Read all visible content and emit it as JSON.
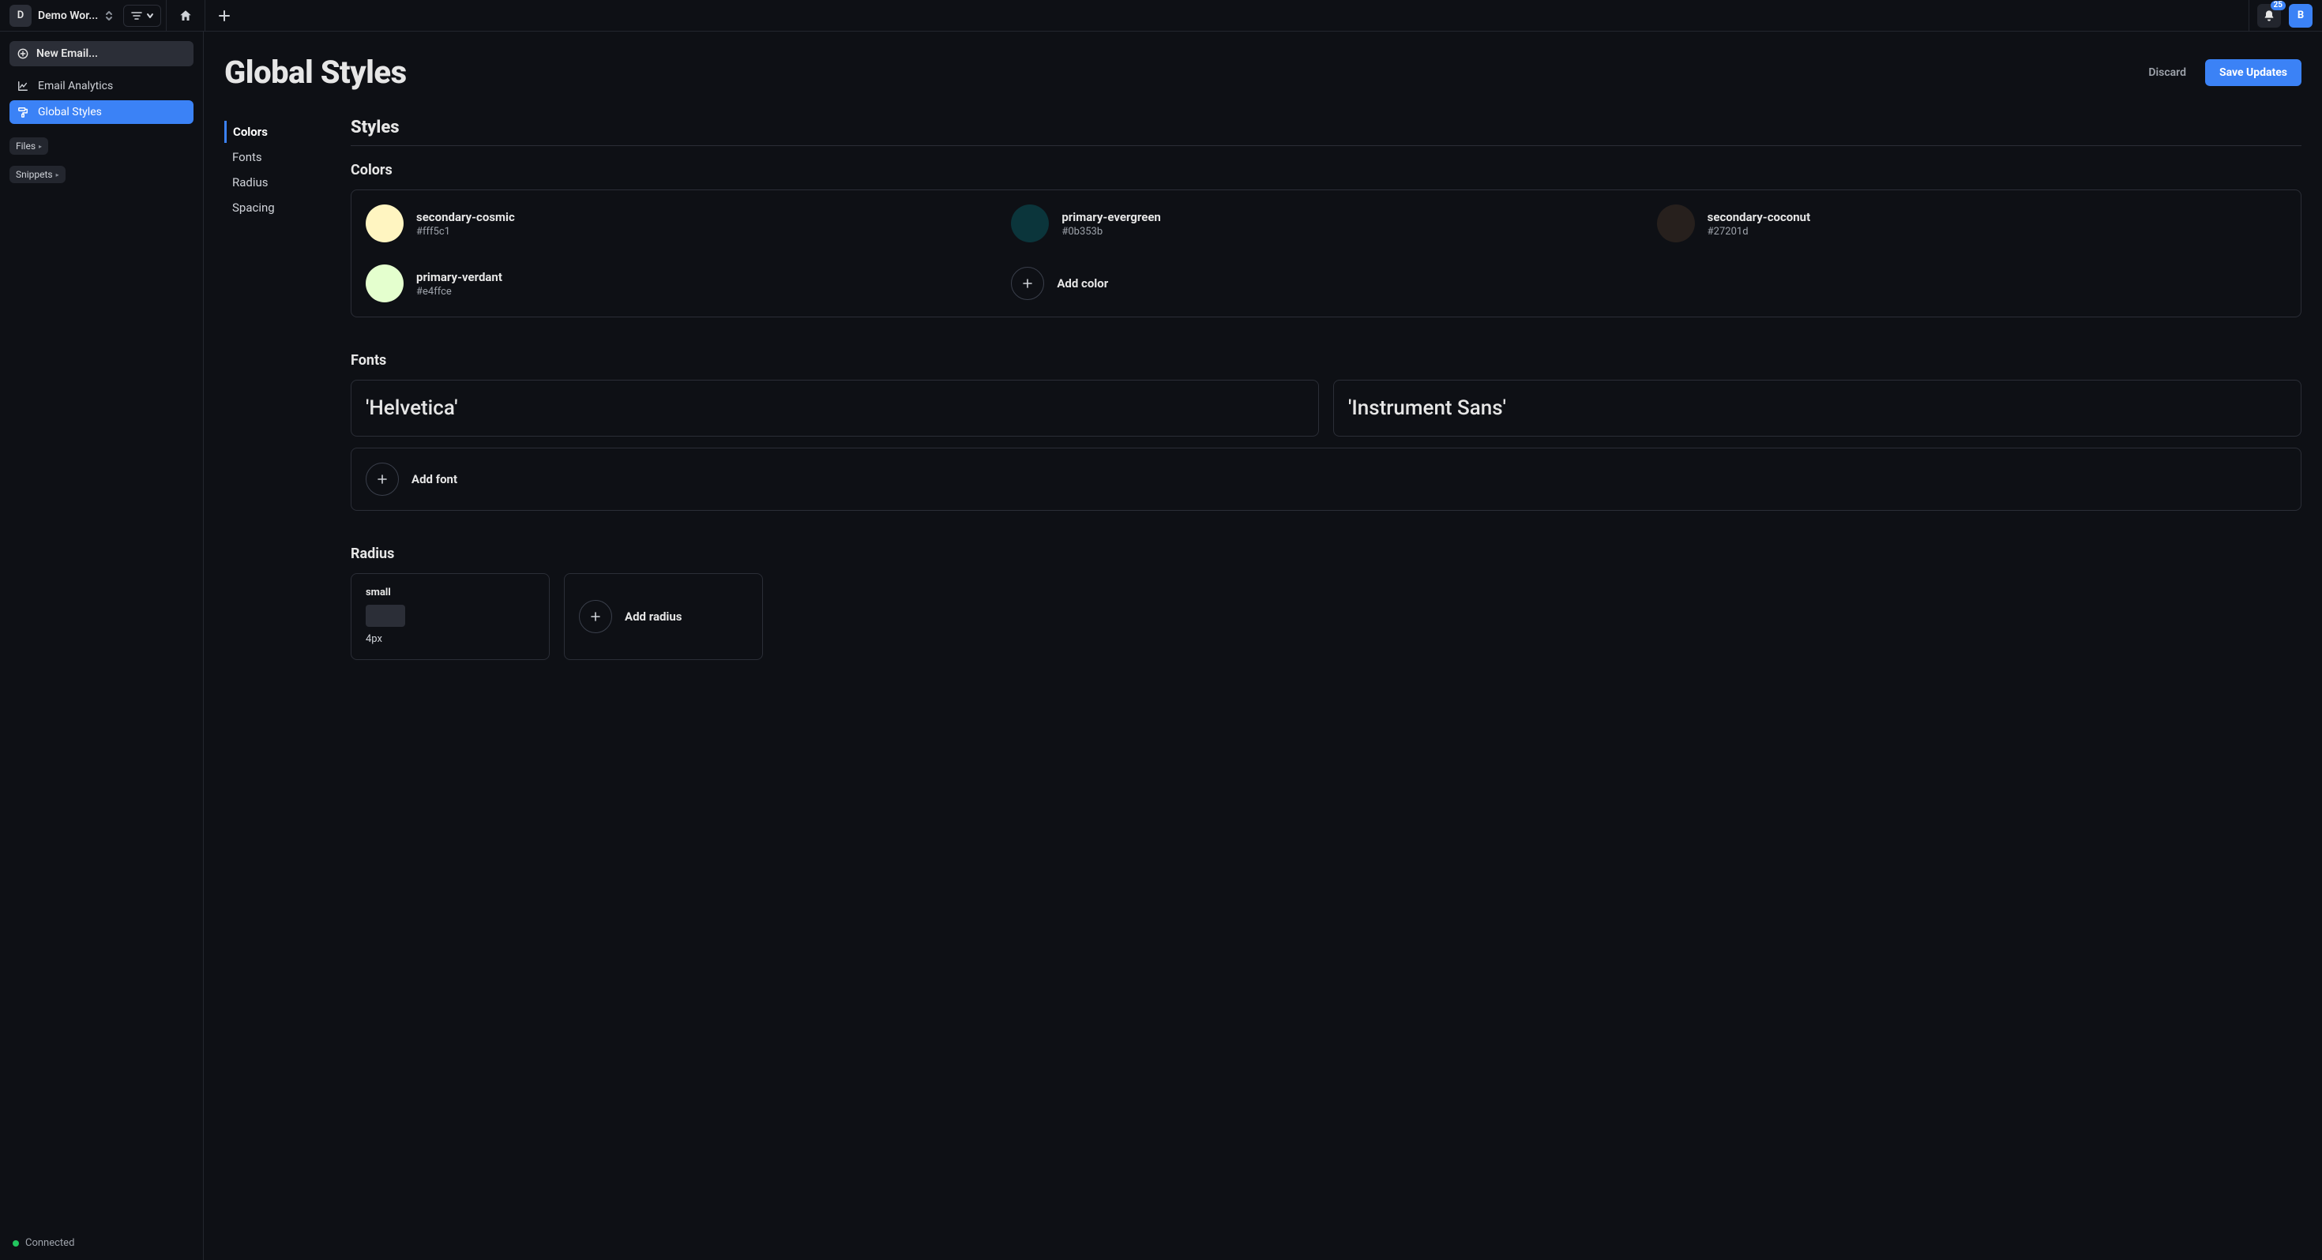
{
  "topbar": {
    "workspace_letter": "D",
    "workspace_name": "Demo Wor...",
    "notification_count": "25",
    "avatar_letter": "B"
  },
  "sidebar": {
    "new_email_label": "New Email...",
    "items": [
      {
        "label": "Email Analytics"
      },
      {
        "label": "Global Styles"
      }
    ],
    "files_label": "Files",
    "snippets_label": "Snippets",
    "status_label": "Connected"
  },
  "header": {
    "title": "Global Styles",
    "discard_label": "Discard",
    "save_label": "Save Updates"
  },
  "subnav": {
    "items": [
      "Colors",
      "Fonts",
      "Radius",
      "Spacing"
    ]
  },
  "styles": {
    "section_title": "Styles",
    "colors": {
      "title": "Colors",
      "items": [
        {
          "name": "secondary-cosmic",
          "hex": "#fff5c1"
        },
        {
          "name": "primary-evergreen",
          "hex": "#0b353b"
        },
        {
          "name": "secondary-coconut",
          "hex": "#27201d"
        },
        {
          "name": "primary-verdant",
          "hex": "#e4ffce"
        }
      ],
      "add_label": "Add color"
    },
    "fonts": {
      "title": "Fonts",
      "items": [
        "'Helvetica'",
        "'Instrument Sans'"
      ],
      "add_label": "Add font"
    },
    "radius": {
      "title": "Radius",
      "items": [
        {
          "name": "small",
          "value": "4px"
        }
      ],
      "add_label": "Add radius"
    }
  }
}
